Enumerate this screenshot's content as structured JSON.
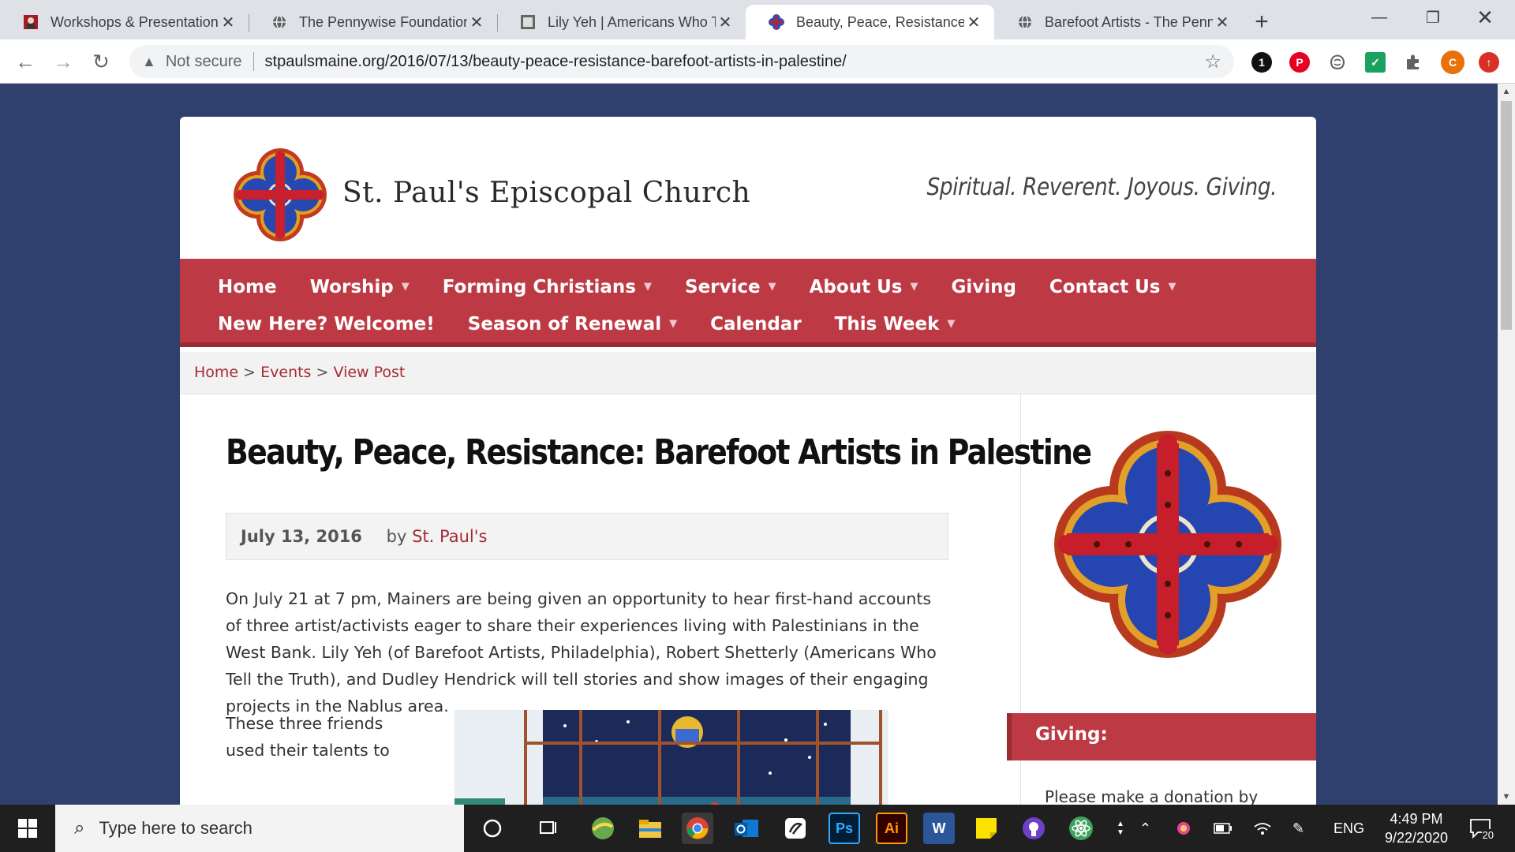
{
  "browser": {
    "tabs": [
      {
        "title": "Workshops & Presentations",
        "icon": "red-portrait-icon",
        "active": false
      },
      {
        "title": "The Pennywise Foundation",
        "icon": "globe-icon",
        "active": false
      },
      {
        "title": "Lily Yeh | Americans Who Te",
        "icon": "square-frame-icon",
        "active": false
      },
      {
        "title": "Beauty, Peace, Resistance: B",
        "icon": "cross-quatrefoil-icon",
        "active": true
      },
      {
        "title": "Barefoot Artists - The Penny",
        "icon": "globe-icon",
        "active": false
      }
    ],
    "tab_close": "✕",
    "new_tab": "+",
    "security_label": "Not secure",
    "url": "stpaulsmaine.org/2016/07/13/beauty-peace-resistance-barefoot-artists-in-palestine/",
    "extensions": [
      {
        "name": "badge-1-icon",
        "text": "1",
        "color": "#111111"
      },
      {
        "name": "pinterest-icon",
        "text": "P",
        "color": "#e60023"
      },
      {
        "name": "brain-icon",
        "text": "",
        "color": "#5f6368"
      },
      {
        "name": "check-icon",
        "text": "✓",
        "color": "#1aa260"
      },
      {
        "name": "puzzle-icon",
        "text": "",
        "color": "#5f6368"
      },
      {
        "name": "profile-avatar",
        "text": "C",
        "color": "#e8710a"
      },
      {
        "name": "update-icon",
        "text": "↑",
        "color": "#d93025"
      }
    ]
  },
  "site": {
    "name": "St. Paul's Episcopal Church",
    "tagline": "Spiritual. Reverent. Joyous. Giving.",
    "nav_row1": [
      {
        "label": "Home",
        "dropdown": false
      },
      {
        "label": "Worship",
        "dropdown": true
      },
      {
        "label": "Forming Christians",
        "dropdown": true
      },
      {
        "label": "Service",
        "dropdown": true
      },
      {
        "label": "About Us",
        "dropdown": true
      },
      {
        "label": "Giving",
        "dropdown": false
      },
      {
        "label": "Contact Us",
        "dropdown": true
      }
    ],
    "nav_row2": [
      {
        "label": "New Here? Welcome!",
        "dropdown": false
      },
      {
        "label": "Season of Renewal",
        "dropdown": true
      },
      {
        "label": "Calendar",
        "dropdown": false
      },
      {
        "label": "This Week",
        "dropdown": true
      }
    ],
    "breadcrumb": {
      "home": "Home",
      "sep": ">",
      "events": "Events",
      "current": "View Post"
    }
  },
  "post": {
    "title": "Beauty, Peace, Resistance: Barefoot Artists in Palestine",
    "date": "July 13, 2016",
    "by": "by",
    "author": "St. Paul's",
    "paragraph1": "On July 21 at 7 pm, Mainers are being given an opportunity to hear first-hand accounts of three artist/activists eager to share their experiences living with Palestinians in the West Bank. Lily Yeh (of Barefoot Artists, Philadelphia), Robert Shetterly (Americans Who Tell the Truth), and Dudley Hendrick will tell stories and show images of their engaging projects in the Nablus area.",
    "paragraph2": "These three friends used their talents to"
  },
  "sidebar": {
    "giving_heading": "Giving:",
    "giving_text": "Please make a donation by"
  },
  "taskbar": {
    "search_placeholder": "Type here to search",
    "language": "ENG",
    "time": "4:49 PM",
    "date": "9/22/2020",
    "notification_count": "20",
    "apps": [
      {
        "name": "cortana-icon"
      },
      {
        "name": "task-view-icon"
      },
      {
        "name": "maps-app-icon"
      },
      {
        "name": "file-explorer-icon"
      },
      {
        "name": "chrome-icon"
      },
      {
        "name": "outlook-icon"
      },
      {
        "name": "pen-app-icon"
      },
      {
        "name": "photoshop-icon",
        "text": "Ps"
      },
      {
        "name": "illustrator-icon",
        "text": "Ai"
      },
      {
        "name": "word-icon",
        "text": "W"
      },
      {
        "name": "sticky-notes-icon"
      },
      {
        "name": "github-desktop-icon"
      },
      {
        "name": "atom-icon"
      }
    ]
  },
  "colors": {
    "page_bg": "#2f3f6e",
    "nav_red": "#bd3a44",
    "link_red": "#a62b35"
  }
}
